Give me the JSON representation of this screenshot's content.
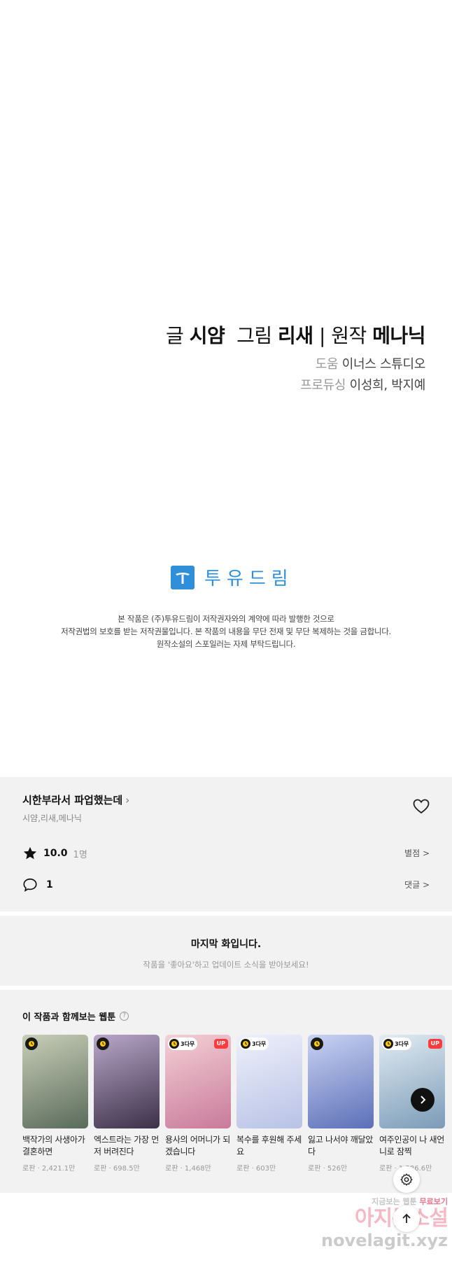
{
  "credits": {
    "story_label": "글",
    "story_name": "시얌",
    "art_label": "그림",
    "art_name": "리새",
    "separator": "|",
    "original_label": "원작",
    "original_name": "메나닉",
    "assist_label": "도움",
    "assist_name": "이너스 스튜디오",
    "producer_label": "프로듀싱",
    "producer_name": "이성희, 박지예"
  },
  "logo": {
    "name": "투유드림",
    "color": "#2f8fd8"
  },
  "notice": {
    "line1": "본 작품은 (주)투유드림이 저작권자와의 계약에 따라 발행한 것으로",
    "line2": "저작권법의 보호를 받는 저작권물입니다. 본 작품의 내용을 무단 전재 및 무단 복제하는 것을 금합니다.",
    "line3": "원작소설의 스포일러는 자제 부탁드립니다."
  },
  "info": {
    "title": "시한부라서 파업했는데",
    "authors": "시얌,리새,메나닉",
    "rating": "10.0",
    "rating_count": "1명",
    "rate_link": "별점 >",
    "comment_count": "1",
    "comment_link": "댓글 >"
  },
  "last_episode": {
    "title": "마지막 화입니다.",
    "subtitle": "작품을 '좋아요'하고 업데이트 소식을 받아보세요!"
  },
  "recommendations": {
    "heading": "이 작품과 함께보는 웹툰",
    "items": [
      {
        "title": "백작가의 사생아가 결혼하면",
        "meta": "로판 · 2,421.1만",
        "wait": "",
        "up": false,
        "colors": [
          "#5a6b5a",
          "#c8ceb8"
        ]
      },
      {
        "title": "엑스트라는 가장 먼저 버려진다",
        "meta": "로판 · 698.5만",
        "wait": "",
        "up": false,
        "colors": [
          "#3b3048",
          "#b9a7c9"
        ]
      },
      {
        "title": "용사의 어머니가 되겠습니다",
        "meta": "로판 · 1,468만",
        "wait": "3다무",
        "up": true,
        "colors": [
          "#c97a9a",
          "#f3d0d6"
        ]
      },
      {
        "title": "복수를 후원해 주세요",
        "meta": "로판 · 603만",
        "wait": "3다무",
        "up": false,
        "colors": [
          "#b8c2e6",
          "#eef0fa"
        ]
      },
      {
        "title": "잃고 나서야 깨달았다",
        "meta": "로판 · 526만",
        "wait": "",
        "up": false,
        "colors": [
          "#5c6fb8",
          "#c9d3f2"
        ]
      },
      {
        "title": "여주인공이 나 새언니로 잠찍",
        "meta": "로판 · 1,286.6만",
        "wait": "3다무",
        "up": true,
        "colors": [
          "#7a9bb8",
          "#e2ecf2"
        ]
      }
    ]
  },
  "watermark": {
    "line1_a": "지금보는 웹툰",
    "line1_b": "무료보기",
    "line2": "아지툰소설",
    "line3": "novelagit.xyz"
  }
}
